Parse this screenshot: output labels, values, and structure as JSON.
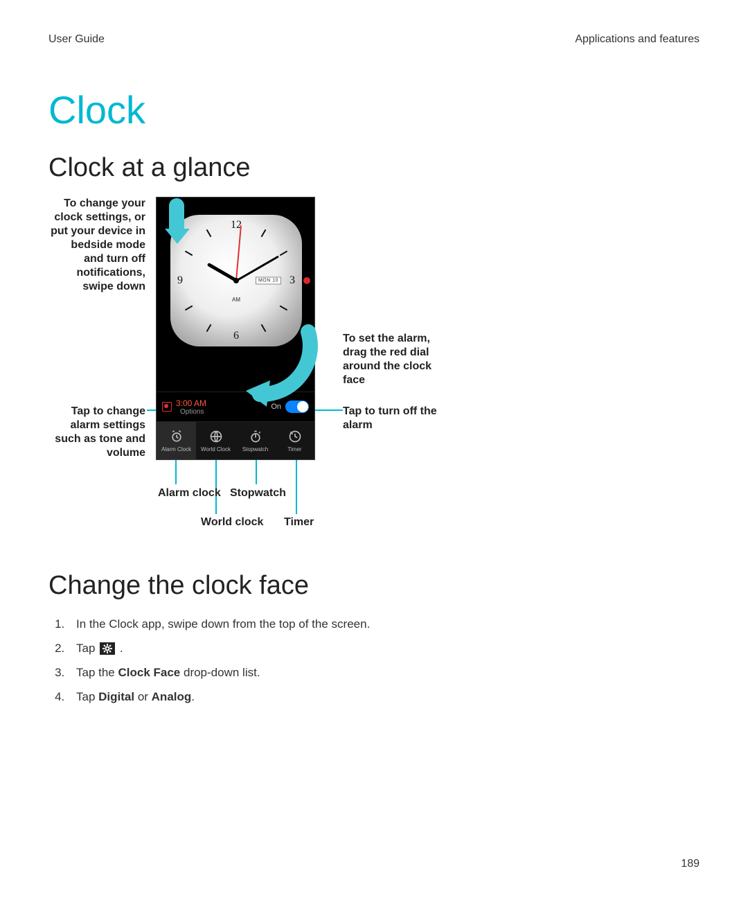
{
  "header": {
    "left": "User Guide",
    "right": "Applications and features"
  },
  "title": "Clock",
  "section1": "Clock at a glance",
  "section2": "Change the clock face",
  "callouts": {
    "swipe_down": "To change your clock settings, or put your device in bedside mode and turn off notifications, swipe down",
    "alarm_settings": "Tap to change alarm settings such as tone and volume",
    "set_alarm": "To set the alarm, drag the red dial around the clock face",
    "turn_off": "Tap to turn off the alarm",
    "tab_alarm": "Alarm clock",
    "tab_world": "World clock",
    "tab_stopwatch": "Stopwatch",
    "tab_timer": "Timer"
  },
  "clock": {
    "n12": "12",
    "n3": "3",
    "n6": "6",
    "n9": "9",
    "date": "MON 10",
    "ampm": "AM"
  },
  "alarm": {
    "time": "3:00 AM",
    "options": "Options",
    "on": "On"
  },
  "tabs": {
    "alarm": "Alarm Clock",
    "world": "World Clock",
    "stopwatch": "Stopwatch",
    "timer": "Timer"
  },
  "steps": {
    "s1": "In the Clock app, swipe down from the top of the screen.",
    "s2a": "Tap ",
    "s2b": " .",
    "s3a": "Tap the ",
    "s3b": "Clock Face",
    "s3c": " drop-down list.",
    "s4a": "Tap ",
    "s4b": "Digital",
    "s4c": " or ",
    "s4d": "Analog",
    "s4e": "."
  },
  "page_number": "189"
}
